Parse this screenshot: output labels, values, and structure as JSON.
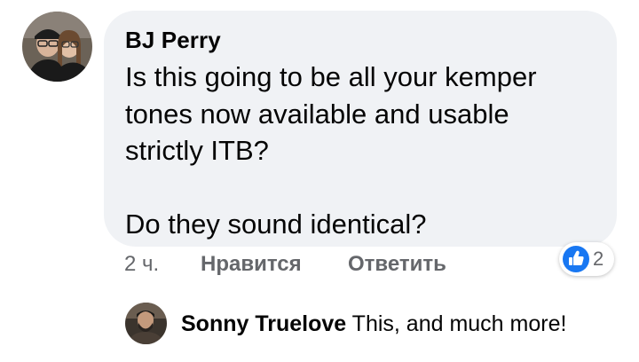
{
  "comment": {
    "author": "BJ Perry",
    "paragraph_1": [
      "Is this going to be all your kemper",
      "tones now available and usable",
      "strictly ITB?"
    ],
    "paragraph_2": "Do they sound identical?",
    "time": "2 ч.",
    "like_label": "Нравится",
    "reply_label": "Ответить",
    "reaction_icon": "like-icon",
    "reaction_count": "2"
  },
  "reply": {
    "author": "Sonny Truelove",
    "text": "This, and much more!"
  },
  "colors": {
    "bubble": "#f0f2f5",
    "secondary_text": "#65676b",
    "like_blue": "#1877f2"
  }
}
